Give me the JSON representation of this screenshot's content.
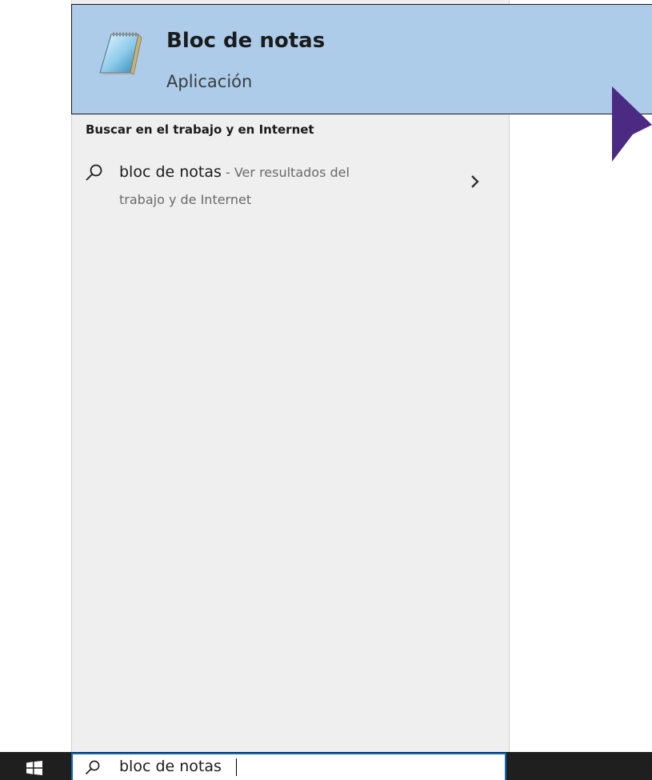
{
  "best_match": {
    "title": "Bloc de notas",
    "subtitle": "Aplicación",
    "icon": "notepad-icon"
  },
  "web_section": {
    "header": "Buscar en el trabajo y en Internet",
    "result": {
      "query": "bloc de notas",
      "hint": " - Ver resultados del",
      "hint_line2": "trabajo y de Internet",
      "icon": "search-icon",
      "arrow_icon": "chevron-right-icon"
    }
  },
  "taskbar": {
    "start_icon": "windows-logo-icon",
    "search": {
      "value": "bloc de notas",
      "icon": "search-icon"
    }
  },
  "colors": {
    "highlight": "#acccea",
    "panel": "#efefef",
    "taskbar": "#1f1f1f",
    "search_border": "#0a6ac0",
    "cursor": "#4b2a84"
  }
}
